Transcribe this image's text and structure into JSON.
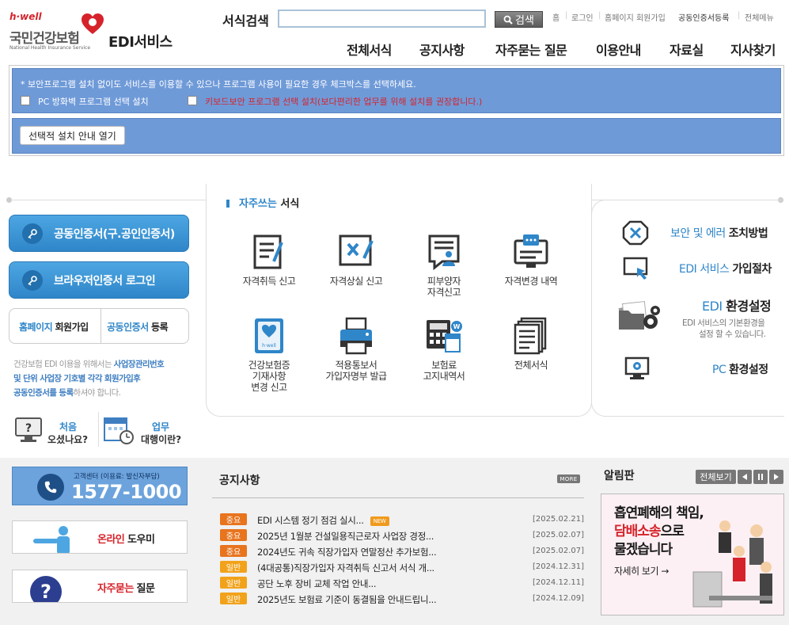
{
  "brand": {
    "hwell": "h·well",
    "org_name": "국민건강보험",
    "org_eng": "National Health Insurance Service",
    "service": "EDI서비스",
    "accent": "#2f86c9",
    "red": "#d6232b"
  },
  "search": {
    "label": "서식검색",
    "value": "",
    "button": "검색"
  },
  "util_links": [
    "홈",
    "로그인",
    "홈페이지 회원가입",
    "공동인증서등록",
    "전체메뉴"
  ],
  "gnb": [
    "전체서식",
    "공지사항",
    "자주묻는 질문",
    "이용안내",
    "자료실",
    "지사찾기"
  ],
  "notice": {
    "line1": "* 보안프로그램 설치 없이도 서비스를 이용할 수 있으나 프로그램 사용이 필요한 경우 체크박스를 선택하세요.",
    "check1": "PC 방화벽 프로그램 선택 설치",
    "check2": "키보드보안 프로그램 선택 설치(보다편리한 업무를 위해 설치를 권장합니다.)",
    "guide_button": "선택적 설치 안내 열기"
  },
  "left": {
    "cert_login": "공동인증서(구.공인인증서)",
    "browser_login": "브라우저인증서 로그인",
    "reg1_blue": "홈페이지",
    "reg1_black": "회원가입",
    "reg2_blue": "공동인증서",
    "reg2_black": "등록",
    "note": {
      "p1": "건강보험 EDI 이용을 위해서는 ",
      "b1": "사업장관리번호",
      "p2": "",
      "b2": "및 단위 사업장 기호별 각각 회원가입후",
      "b3": "공동인증서를 등록",
      "p3": "하셔야 합니다."
    },
    "first_t1": "처음",
    "first_t2": "오셨나요?",
    "proxy_t1": "업무",
    "proxy_t2": "대행이란?"
  },
  "favorites": {
    "title_blue": "자주쓰는",
    "title_black": "서식",
    "items": [
      {
        "label": "자격취득 신고",
        "icon": "form-acquire-icon"
      },
      {
        "label": "자격상실 신고",
        "icon": "form-loss-icon"
      },
      {
        "label": "피부양자\n자격신고",
        "icon": "dependent-icon"
      },
      {
        "label": "자격변경 내역",
        "icon": "change-history-icon"
      },
      {
        "label": "건강보험증\n기재사항\n변경 신고",
        "icon": "insurance-card-icon"
      },
      {
        "label": "적용통보서\n가입자명부 발급",
        "icon": "printer-icon"
      },
      {
        "label": "보험료\n고지내역서",
        "icon": "calculator-icon"
      },
      {
        "label": "전체서식",
        "icon": "all-forms-icon"
      }
    ]
  },
  "right": {
    "error_blue": "보안 및 에러",
    "error_black": "조치방법",
    "join_blue": "EDI 서비스",
    "join_black": "가입절차",
    "env_blue": "EDI",
    "env_black": "환경설정",
    "env_desc1": "EDI 서비스의 기본환경을",
    "env_desc2": "설정 할 수 있습니다.",
    "pc_blue": "PC",
    "pc_black": "환경설정"
  },
  "callcenter": {
    "label": "고객센터 (이용료: 발신자부담)",
    "number": "1577-1000"
  },
  "side_links": {
    "online_red": "온라인",
    "online_black": "도우미",
    "faq_red": "자주묻는",
    "faq_black": "질문"
  },
  "news": {
    "title": "공지사항",
    "more": "MORE",
    "new_tag": "NEW",
    "rows": [
      {
        "badge": "중요",
        "text": "EDI 시스템 정기 점검 실시...",
        "date": "[2025.02.21]",
        "is_new": true
      },
      {
        "badge": "중요",
        "text": "2025년 1월분 건설일용직근로자 사업장 경정...",
        "date": "[2025.02.07]",
        "is_new": false
      },
      {
        "badge": "중요",
        "text": "2024년도 귀속 직장가입자 연말정산 추가보험...",
        "date": "[2025.02.07]",
        "is_new": false
      },
      {
        "badge": "일반",
        "text": "(4대공통)직장가입자 자격취득 신고서 서식 개...",
        "date": "[2024.12.31]",
        "is_new": false
      },
      {
        "badge": "일반",
        "text": "공단 노후 장비 교체 작업 안내...",
        "date": "[2024.12.11]",
        "is_new": false
      },
      {
        "badge": "일반",
        "text": "2025년도 보험료 기준이 동결됨을 안내드립니...",
        "date": "[2024.12.09]",
        "is_new": false
      }
    ],
    "badge_colors": {
      "중요": "#e8741e",
      "일반": "#f2a21a"
    }
  },
  "board": {
    "title": "알림판",
    "view_all": "전체보기",
    "banner_l1": "흡연폐해의 책임,",
    "banner_l2a": "담배소송",
    "banner_l2b": "으로",
    "banner_l3": "물겠습니다",
    "banner_more": "자세히 보기 →"
  }
}
